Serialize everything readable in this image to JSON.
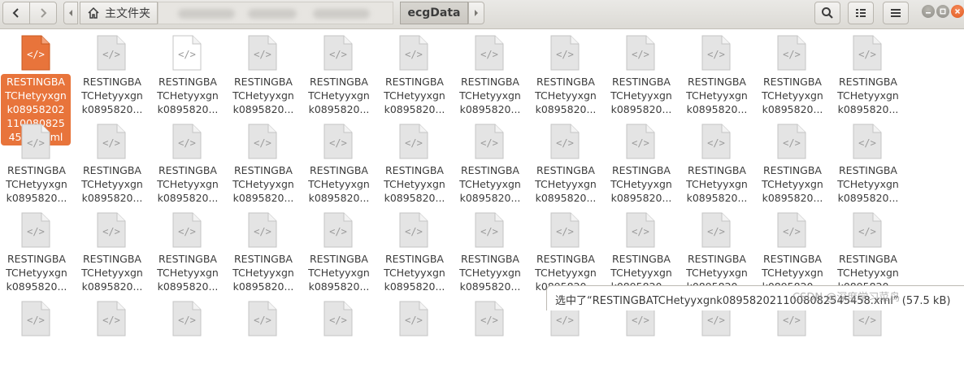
{
  "header": {
    "home_label": "主文件夹",
    "active_crumb": "ecgData"
  },
  "files": {
    "selected_full_label": [
      "RESTINGBA",
      "TCHetyyxgn",
      "k08958202",
      "110080825",
      "45458.xml"
    ],
    "truncated_label": [
      "RESTINGBA",
      "TCHetyyxgn",
      "k0895820..."
    ]
  },
  "status": {
    "text": "选中了“RESTINGBATCHetyyxgnk08958202110080825​45458.xml” (57.5 kB)"
  },
  "watermark": {
    "text": "CSDN @深度学习菜鸟"
  },
  "colors": {
    "accent": "#e8743b",
    "headerbar": "#dcdad5",
    "icon_fill": "#e6e6e6"
  },
  "icons": [
    "go-back-icon",
    "go-forward-icon",
    "home-icon",
    "search-icon",
    "view-options-icon",
    "menu-icon",
    "minimize-icon",
    "maximize-icon",
    "close-icon",
    "xml-file-icon"
  ]
}
